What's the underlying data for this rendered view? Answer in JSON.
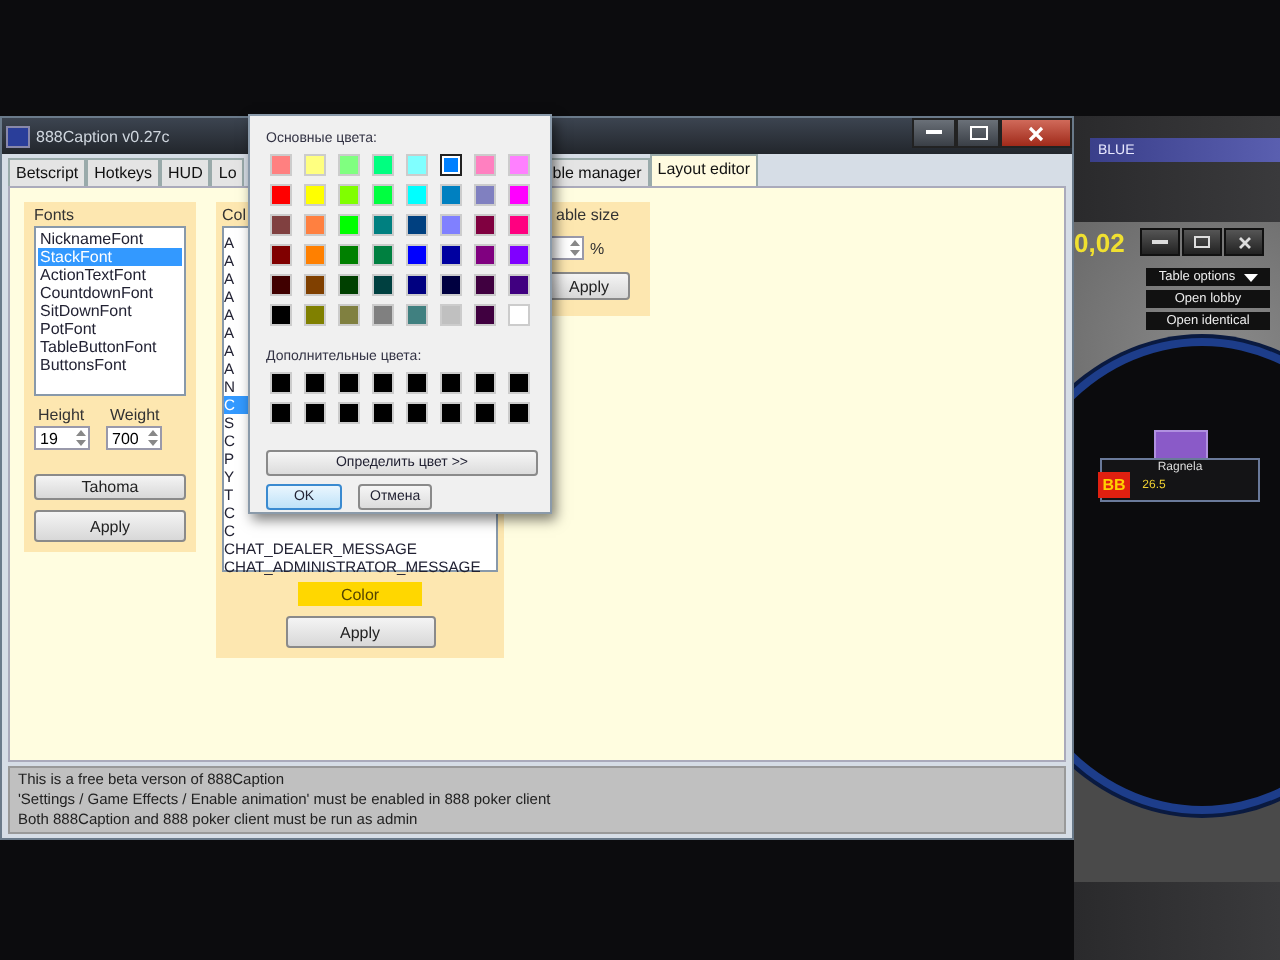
{
  "app_window": {
    "title": "888Caption v0.27c",
    "tabs": [
      {
        "label": "Betscript",
        "selected": false
      },
      {
        "label": "Hotkeys",
        "selected": false
      },
      {
        "label": "HUD",
        "selected": false
      },
      {
        "label": "Lo",
        "selected": false
      },
      {
        "label": "ble manager",
        "selected": false
      },
      {
        "label": "Layout editor",
        "selected": true
      }
    ],
    "fonts_group": {
      "label": "Fonts",
      "items": [
        {
          "label": "NicknameFont",
          "selected": false
        },
        {
          "label": "StackFont",
          "selected": true
        },
        {
          "label": "ActionTextFont",
          "selected": false
        },
        {
          "label": "CountdownFont",
          "selected": false
        },
        {
          "label": "SitDownFont",
          "selected": false
        },
        {
          "label": "PotFont",
          "selected": false
        },
        {
          "label": "TableButtonFont",
          "selected": false
        },
        {
          "label": "ButtonsFont",
          "selected": false
        }
      ],
      "height_label": "Height",
      "height_value": "19",
      "weight_label": "Weight",
      "weight_value": "700",
      "font_button": "Tahoma",
      "apply_button": "Apply"
    },
    "color_group": {
      "label": "Col",
      "items": [
        {
          "label": "A",
          "selected": false
        },
        {
          "label": "A",
          "selected": false
        },
        {
          "label": "A",
          "selected": false
        },
        {
          "label": "A",
          "selected": false
        },
        {
          "label": "A",
          "selected": false
        },
        {
          "label": "A",
          "selected": false
        },
        {
          "label": "A",
          "selected": false
        },
        {
          "label": "A",
          "selected": false
        },
        {
          "label": "N",
          "selected": false
        },
        {
          "label": "C",
          "selected": true
        },
        {
          "label": "S",
          "selected": false
        },
        {
          "label": "C",
          "selected": false
        },
        {
          "label": "P",
          "selected": false
        },
        {
          "label": "Y",
          "selected": false
        },
        {
          "label": "T",
          "selected": false
        },
        {
          "label": "C",
          "selected": false
        },
        {
          "label": "C",
          "selected": false
        },
        {
          "label": "CHAT_DEALER_MESSAGE",
          "selected": false
        },
        {
          "label": "CHAT_ADMINISTRATOR_MESSAGE",
          "selected": false
        }
      ],
      "color_button": "Color",
      "apply_button": "Apply"
    },
    "table_size_group": {
      "label": "able size",
      "unit": "%",
      "apply_button": "Apply"
    },
    "status_lines": [
      "This is a free beta verson of 888Caption",
      "'Settings / Game Effects / Enable animation' must be enabled in 888 poker client",
      "Both 888Caption and 888 poker client must be run as admin"
    ]
  },
  "color_dialog": {
    "basic_label": "Основные цвета:",
    "basic_colors": [
      {
        "color": "#ff8080",
        "selected": false
      },
      {
        "color": "#ffff80",
        "selected": false
      },
      {
        "color": "#80ff80",
        "selected": false
      },
      {
        "color": "#00ff80",
        "selected": false
      },
      {
        "color": "#80ffff",
        "selected": false
      },
      {
        "color": "#0080ff",
        "selected": true
      },
      {
        "color": "#ff80c0",
        "selected": false
      },
      {
        "color": "#ff80ff",
        "selected": false
      },
      {
        "color": "#ff0000",
        "selected": false
      },
      {
        "color": "#ffff00",
        "selected": false
      },
      {
        "color": "#80ff00",
        "selected": false
      },
      {
        "color": "#00ff40",
        "selected": false
      },
      {
        "color": "#00ffff",
        "selected": false
      },
      {
        "color": "#0080c0",
        "selected": false
      },
      {
        "color": "#8080c0",
        "selected": false
      },
      {
        "color": "#ff00ff",
        "selected": false
      },
      {
        "color": "#804040",
        "selected": false
      },
      {
        "color": "#ff8040",
        "selected": false
      },
      {
        "color": "#00ff00",
        "selected": false
      },
      {
        "color": "#008080",
        "selected": false
      },
      {
        "color": "#004080",
        "selected": false
      },
      {
        "color": "#8080ff",
        "selected": false
      },
      {
        "color": "#800040",
        "selected": false
      },
      {
        "color": "#ff0080",
        "selected": false
      },
      {
        "color": "#800000",
        "selected": false
      },
      {
        "color": "#ff8000",
        "selected": false
      },
      {
        "color": "#008000",
        "selected": false
      },
      {
        "color": "#008040",
        "selected": false
      },
      {
        "color": "#0000ff",
        "selected": false
      },
      {
        "color": "#0000a0",
        "selected": false
      },
      {
        "color": "#800080",
        "selected": false
      },
      {
        "color": "#8000ff",
        "selected": false
      },
      {
        "color": "#400000",
        "selected": false
      },
      {
        "color": "#804000",
        "selected": false
      },
      {
        "color": "#004000",
        "selected": false
      },
      {
        "color": "#004040",
        "selected": false
      },
      {
        "color": "#000080",
        "selected": false
      },
      {
        "color": "#000040",
        "selected": false
      },
      {
        "color": "#400040",
        "selected": false
      },
      {
        "color": "#400080",
        "selected": false
      },
      {
        "color": "#000000",
        "selected": false
      },
      {
        "color": "#808000",
        "selected": false
      },
      {
        "color": "#808040",
        "selected": false
      },
      {
        "color": "#808080",
        "selected": false
      },
      {
        "color": "#408080",
        "selected": false
      },
      {
        "color": "#c0c0c0",
        "selected": false
      },
      {
        "color": "#400040",
        "selected": false
      },
      {
        "color": "#ffffff",
        "selected": false
      }
    ],
    "custom_label": "Дополнительные цвета:",
    "custom_colors": [
      {
        "color": "#000000"
      },
      {
        "color": "#000000"
      },
      {
        "color": "#000000"
      },
      {
        "color": "#000000"
      },
      {
        "color": "#000000"
      },
      {
        "color": "#000000"
      },
      {
        "color": "#000000"
      },
      {
        "color": "#000000"
      },
      {
        "color": "#000000"
      },
      {
        "color": "#000000"
      },
      {
        "color": "#000000"
      },
      {
        "color": "#000000"
      },
      {
        "color": "#000000"
      },
      {
        "color": "#000000"
      },
      {
        "color": "#000000"
      },
      {
        "color": "#000000"
      }
    ],
    "define_button": "Определить цвет >>",
    "ok_button": "OK",
    "cancel_button": "Отмена"
  },
  "poker_table": {
    "title": "BLUE",
    "stakes": "0,02",
    "menu_buttons": [
      "Table options",
      "Open lobby",
      "Open identical"
    ],
    "player": {
      "name": "Ragnela",
      "stack": "26.5",
      "badge": "BB"
    }
  }
}
